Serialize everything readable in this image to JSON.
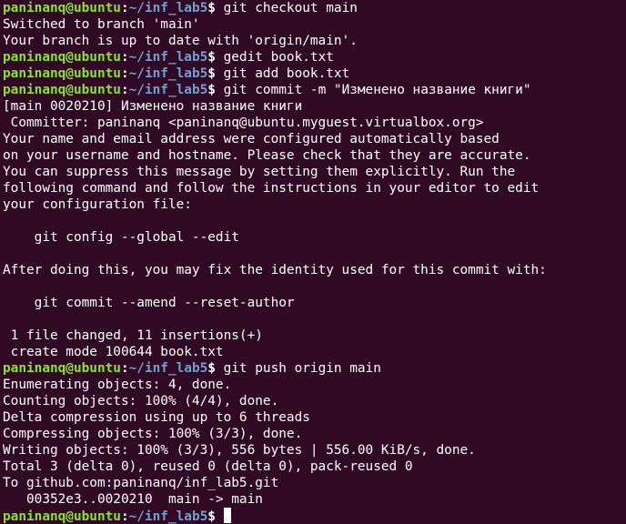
{
  "prompt": {
    "user_host": "paninanq@ubuntu",
    "separator": ":",
    "path": "~/inf_lab5",
    "symbol": "$ "
  },
  "lines": [
    {
      "type": "prompt",
      "command": "git checkout main"
    },
    {
      "type": "out",
      "text": "Switched to branch 'main'"
    },
    {
      "type": "out",
      "text": "Your branch is up to date with 'origin/main'."
    },
    {
      "type": "prompt",
      "command": "gedit book.txt"
    },
    {
      "type": "prompt",
      "command": "git add book.txt"
    },
    {
      "type": "prompt",
      "command": "git commit -m \"Изменено название книги\""
    },
    {
      "type": "out",
      "text": "[main 0020210] Изменено название книги"
    },
    {
      "type": "out",
      "text": " Committer: paninanq <paninanq@ubuntu.myguest.virtualbox.org>"
    },
    {
      "type": "out",
      "text": "Your name and email address were configured automatically based"
    },
    {
      "type": "out",
      "text": "on your username and hostname. Please check that they are accurate."
    },
    {
      "type": "out",
      "text": "You can suppress this message by setting them explicitly. Run the"
    },
    {
      "type": "out",
      "text": "following command and follow the instructions in your editor to edit"
    },
    {
      "type": "out",
      "text": "your configuration file:"
    },
    {
      "type": "out",
      "text": ""
    },
    {
      "type": "out",
      "text": "    git config --global --edit"
    },
    {
      "type": "out",
      "text": ""
    },
    {
      "type": "out",
      "text": "After doing this, you may fix the identity used for this commit with:"
    },
    {
      "type": "out",
      "text": ""
    },
    {
      "type": "out",
      "text": "    git commit --amend --reset-author"
    },
    {
      "type": "out",
      "text": ""
    },
    {
      "type": "out",
      "text": " 1 file changed, 11 insertions(+)"
    },
    {
      "type": "out",
      "text": " create mode 100644 book.txt"
    },
    {
      "type": "prompt",
      "command": "git push origin main"
    },
    {
      "type": "out",
      "text": "Enumerating objects: 4, done."
    },
    {
      "type": "out",
      "text": "Counting objects: 100% (4/4), done."
    },
    {
      "type": "out",
      "text": "Delta compression using up to 6 threads"
    },
    {
      "type": "out",
      "text": "Compressing objects: 100% (3/3), done."
    },
    {
      "type": "out",
      "text": "Writing objects: 100% (3/3), 556 bytes | 556.00 KiB/s, done."
    },
    {
      "type": "out",
      "text": "Total 3 (delta 0), reused 0 (delta 0), pack-reused 0"
    },
    {
      "type": "out",
      "text": "To github.com:paninanq/inf_lab5.git"
    },
    {
      "type": "out",
      "text": "   00352e3..0020210  main -> main"
    },
    {
      "type": "prompt",
      "command": "",
      "cursor": true
    }
  ],
  "colors": {
    "background": "#300a24",
    "text": "#ffffff",
    "user": "#8ae234",
    "path": "#729fcf"
  }
}
